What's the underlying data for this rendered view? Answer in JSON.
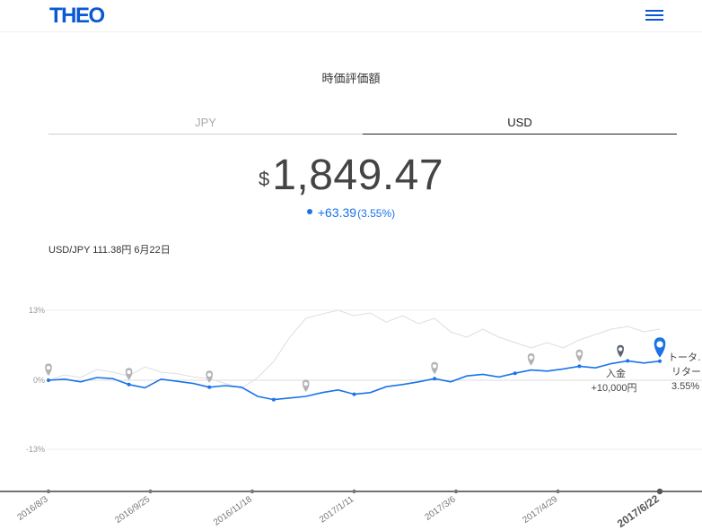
{
  "header": {
    "logo": "THEO",
    "menu_icon": "hamburger-menu-icon"
  },
  "section_title": "時価評価額",
  "tabs": [
    {
      "label": "JPY",
      "active": false
    },
    {
      "label": "USD",
      "active": true
    }
  ],
  "value": {
    "currency_symbol": "$",
    "amount": "1,849.47"
  },
  "change": {
    "amount": "+63.39",
    "percent": "(3.55%)"
  },
  "exchange_rate": "USD/JPY 111.38円 6月22日",
  "chart": {
    "y_ticks": [
      "13%",
      "0%",
      "-13%"
    ],
    "x_ticks": [
      "2016/8/3",
      "2016/9/25",
      "2016/11/18",
      "2017/1/11",
      "2017/3/6",
      "2017/4/29",
      "2017/6/22"
    ],
    "active_x_tick": "2017/6/22",
    "deposit_label": "入金",
    "deposit_amount": "+10,000円",
    "total_return_label": "トータ…",
    "return_label": "リター",
    "return_value": "3.55%",
    "colors": {
      "line": "#1a73e8",
      "benchmark": "#dcdcdc",
      "marker": "#1a73e8",
      "pin_gray": "#b0b0b0"
    }
  },
  "chart_data": {
    "type": "line",
    "y_unit": "%",
    "ylim": [
      -13,
      13
    ],
    "x_ticks": [
      "2016/8/3",
      "2016/9/25",
      "2016/11/18",
      "2017/1/11",
      "2017/3/6",
      "2017/4/29",
      "2017/6/22"
    ],
    "series": [
      {
        "values": [
          0,
          0.2,
          -0.3,
          0.5,
          0.3,
          -0.8,
          -1.4,
          0.2,
          -0.2,
          -0.6,
          -1.3,
          -1.0,
          -1.3,
          -3.0,
          -3.6,
          -3.3,
          -3.0,
          -2.3,
          -1.8,
          -2.6,
          -2.3,
          -1.2,
          -0.8,
          -0.3,
          0.3,
          -0.3,
          0.8,
          1.1,
          0.6,
          1.3,
          1.9,
          1.7,
          2.1,
          2.6,
          2.3,
          3.1,
          3.6,
          3.2,
          3.55
        ]
      },
      {
        "values": [
          0,
          1.0,
          0.5,
          2.0,
          1.5,
          0.8,
          2.5,
          1.5,
          1.2,
          0.6,
          0.3,
          -0.6,
          -1.5,
          0.5,
          3.5,
          8.0,
          11.5,
          12.3,
          13.0,
          12.0,
          12.5,
          10.8,
          12.0,
          10.5,
          11.5,
          9.0,
          8.0,
          9.5,
          8.0,
          7.0,
          6.0,
          7.0,
          6.0,
          7.5,
          8.5,
          9.5,
          10.0,
          9.0,
          9.5
        ]
      }
    ]
  }
}
